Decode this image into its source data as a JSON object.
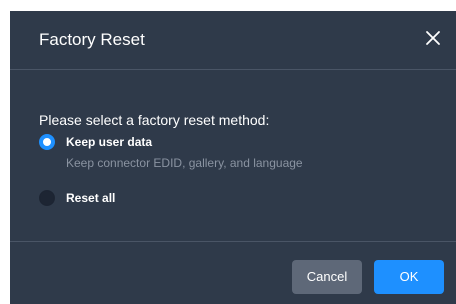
{
  "dialog": {
    "title": "Factory Reset",
    "close_icon": "close-icon",
    "prompt": "Please select a factory reset method:",
    "options": [
      {
        "label": "Keep user data",
        "description": "Keep connector EDID, gallery, and language",
        "selected": true
      },
      {
        "label": "Reset all",
        "selected": false
      }
    ],
    "buttons": {
      "cancel_label": "Cancel",
      "ok_label": "OK"
    }
  },
  "colors": {
    "dialog_background": "#2f3a4a",
    "accent": "#1e90ff",
    "cancel_button": "#5e6878",
    "muted_text": "#8a93a1",
    "divider": "#4a5566"
  }
}
